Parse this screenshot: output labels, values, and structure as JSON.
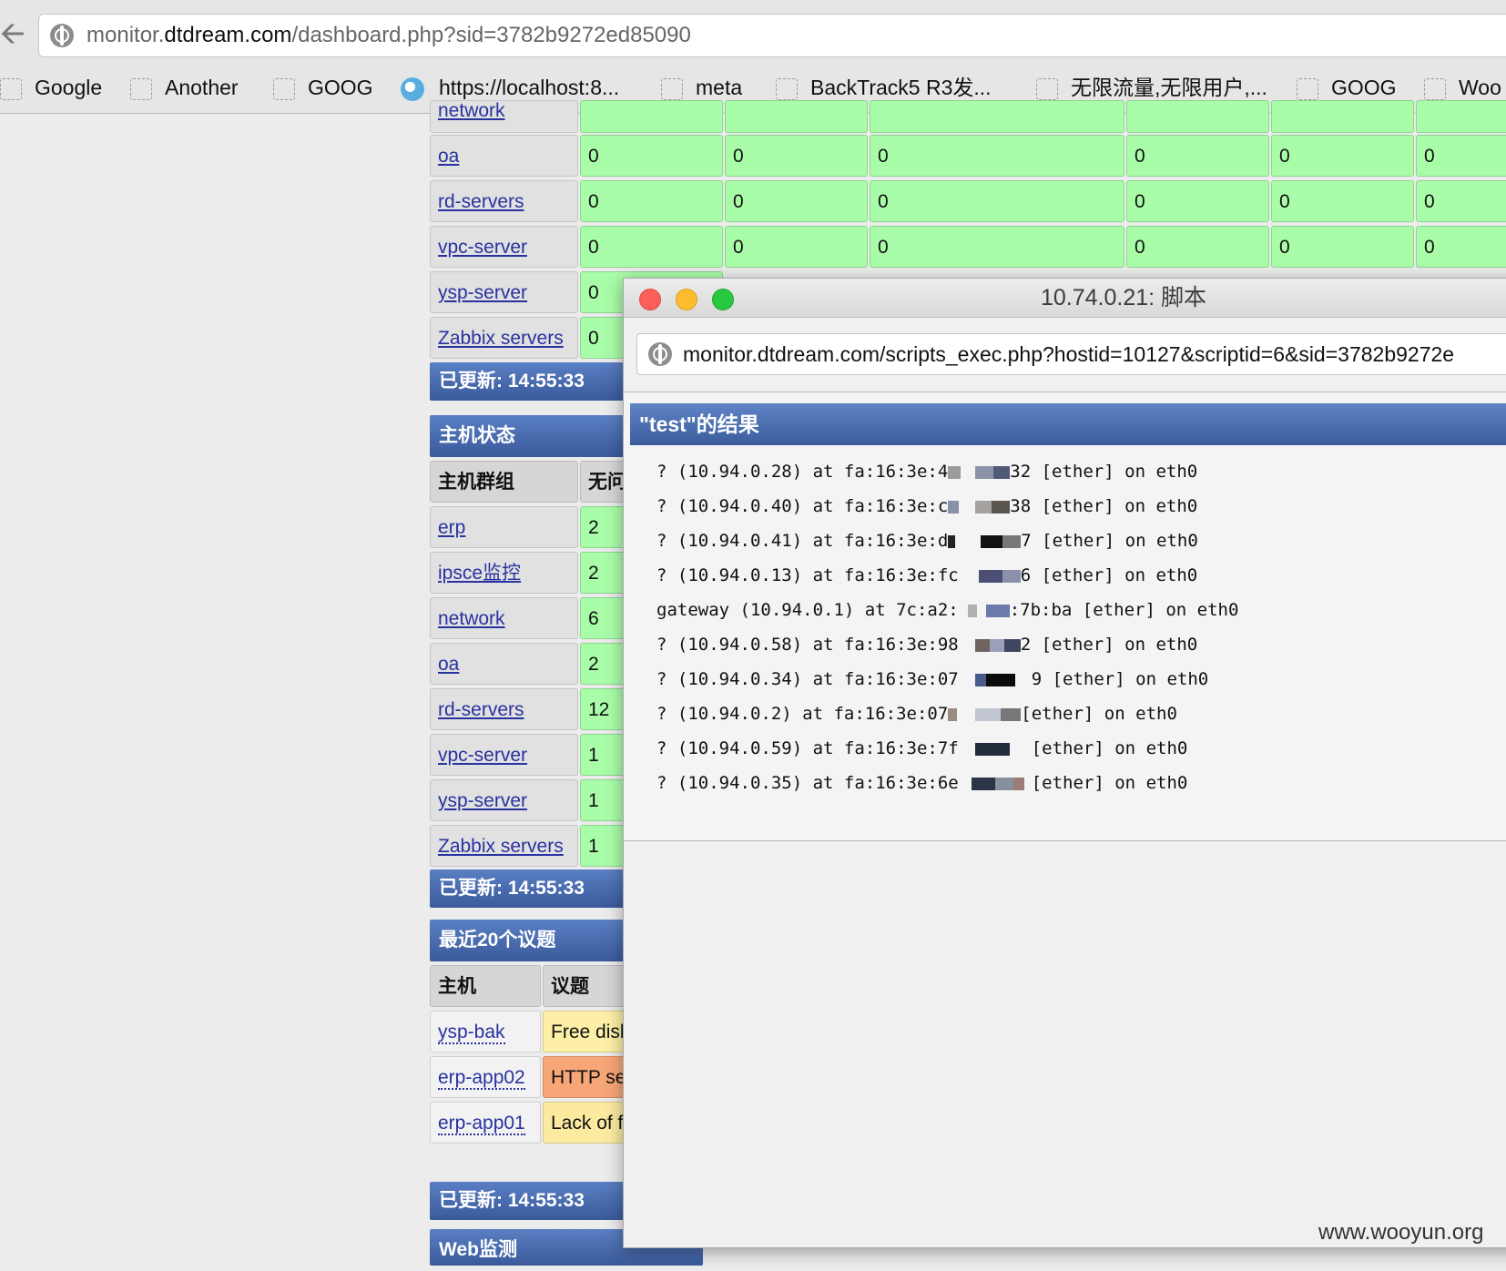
{
  "browser": {
    "url_host": "monitor.dtdream.com",
    "url_path": "/dashboard.php?sid=3782b9272ed85090",
    "url_sub": "monitor.",
    "url_domain": "dtdream.com",
    "bookmarks": [
      "Google",
      "Another",
      "GOOG",
      "https://localhost:8...",
      "meta",
      "BackTrack5 R3发...",
      "无限流量,无限用户,...",
      "GOOG",
      "Woo"
    ]
  },
  "dashboard": {
    "top_table": {
      "partial_row_label": "network",
      "rows": [
        {
          "group": "oa",
          "values": [
            "0",
            "0",
            "0",
            "0",
            "0",
            "0"
          ]
        },
        {
          "group": "rd-servers",
          "values": [
            "0",
            "0",
            "0",
            "0",
            "0",
            "0"
          ]
        },
        {
          "group": "vpc-server",
          "values": [
            "0",
            "0",
            "0",
            "0",
            "0",
            "0"
          ]
        },
        {
          "group": "ysp-server",
          "values": [
            "0"
          ]
        },
        {
          "group": "Zabbix servers",
          "values": [
            "0"
          ]
        }
      ],
      "updated": "已更新: 14:55:33"
    },
    "host_status": {
      "title": "主机状态",
      "col_group": "主机群组",
      "col_ok": "无问",
      "rows": [
        {
          "group": "erp",
          "value": "2"
        },
        {
          "group": "ipsce监控",
          "value": "2"
        },
        {
          "group": "network",
          "value": "6"
        },
        {
          "group": "oa",
          "value": "2"
        },
        {
          "group": "rd-servers",
          "value": "12"
        },
        {
          "group": "vpc-server",
          "value": "1"
        },
        {
          "group": "ysp-server",
          "value": "1"
        },
        {
          "group": "Zabbix servers",
          "value": "1"
        }
      ],
      "updated": "已更新: 14:55:33"
    },
    "recent_issues": {
      "title": "最近20个议题",
      "col_host": "主机",
      "col_issue": "议题",
      "rows": [
        {
          "host": "ysp-bak",
          "issue": "Free disk"
        },
        {
          "host": "erp-app02",
          "issue": "HTTP se"
        },
        {
          "host": "erp-app01",
          "issue": "Lack of f"
        }
      ],
      "updated": "已更新: 14:55:33"
    },
    "web_monitor_title": "Web监测"
  },
  "popup": {
    "window_title": "10.74.0.21: 脚本",
    "url": "monitor.dtdream.com/scripts_exec.php?hostid=10127&scriptid=6&sid=3782b9272e",
    "result_title": "\"test\"的结果",
    "output_lines": [
      {
        "pre": "? (10.94.0.28) at fa:16:3e:4",
        "post": "32 [ether] on eth0"
      },
      {
        "pre": "? (10.94.0.40) at fa:16:3e:c",
        "post": "38 [ether] on eth0"
      },
      {
        "pre": "? (10.94.0.41) at fa:16:3e:d",
        "post": "7 [ether] on eth0"
      },
      {
        "pre": "? (10.94.0.13) at fa:16:3e:fc",
        "post": "6 [ether] on eth0"
      },
      {
        "pre": "gateway (10.94.0.1) at 7c:a2:",
        "post": ":7b:ba [ether] on eth0"
      },
      {
        "pre": "? (10.94.0.58) at fa:16:3e:98",
        "post": "2 [ether] on eth0"
      },
      {
        "pre": "? (10.94.0.34) at fa:16:3e:07",
        "post": "9 [ether] on eth0"
      },
      {
        "pre": "? (10.94.0.2) at fa:16:3e:07",
        "post": "[ether] on eth0"
      },
      {
        "pre": "? (10.94.0.59) at fa:16:3e:7f",
        "post": "[ether] on eth0"
      },
      {
        "pre": "? (10.94.0.35) at fa:16:3e:6e",
        "post": "[ether] on eth0"
      }
    ]
  },
  "watermark": "www.wooyun.org"
}
